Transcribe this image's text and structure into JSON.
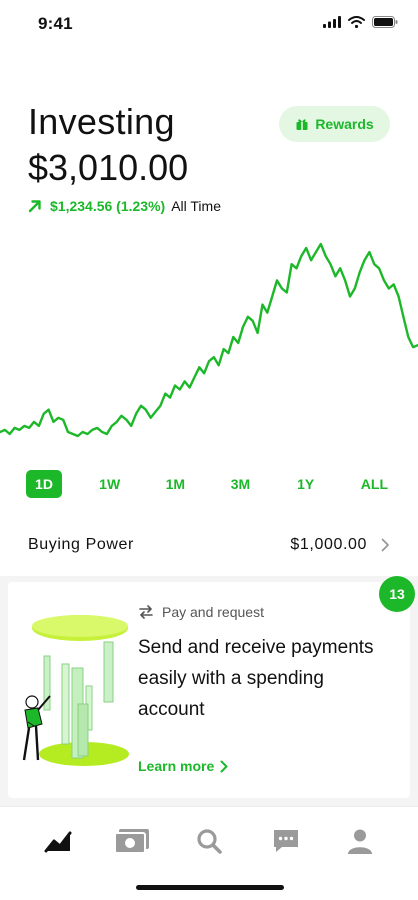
{
  "status_bar": {
    "time": "9:41",
    "icons": [
      "cellular-signal-icon",
      "wifi-icon",
      "battery-icon"
    ]
  },
  "header": {
    "title": "Investing",
    "balance": "$3,010.00",
    "change": {
      "direction_icon": "arrow-up-right-icon",
      "value": "$1,234.56 (1.23%)",
      "period": "All Time"
    }
  },
  "rewards_button": {
    "icon": "gift-icon",
    "label": "Rewards"
  },
  "chart": {
    "type": "line",
    "line_color": "#1cb82a",
    "values": [
      3,
      4,
      2,
      5,
      4,
      6,
      5,
      8,
      6,
      12,
      14,
      8,
      10,
      9,
      3,
      2,
      1,
      3,
      2,
      4,
      5,
      3,
      2,
      6,
      8,
      11,
      9,
      6,
      12,
      16,
      14,
      10,
      13,
      16,
      22,
      20,
      26,
      24,
      28,
      25,
      30,
      35,
      32,
      38,
      40,
      36,
      44,
      42,
      50,
      47,
      55,
      60,
      58,
      52,
      66,
      62,
      70,
      78,
      74,
      72,
      86,
      84,
      90,
      94,
      88,
      92,
      96,
      90,
      86,
      80,
      84,
      78,
      70,
      74,
      82,
      88,
      92,
      86,
      84,
      78,
      74,
      76,
      70,
      60,
      50,
      45,
      46
    ]
  },
  "range_selector": {
    "options": [
      "1D",
      "1W",
      "1M",
      "3M",
      "1Y",
      "ALL"
    ],
    "selected": "1D"
  },
  "buying_power": {
    "label": "Buying Power",
    "value": "$1,000.00"
  },
  "promo_card": {
    "badge_count": "13",
    "kicker_icon": "transfer-arrows-icon",
    "kicker": "Pay and request",
    "text": "Send and receive payments easily with a spending account",
    "link_label": "Learn more"
  },
  "tab_bar": {
    "tabs": [
      {
        "icon": "chart-tab-icon",
        "active": true
      },
      {
        "icon": "cash-tab-icon",
        "active": false
      },
      {
        "icon": "search-tab-icon",
        "active": false
      },
      {
        "icon": "messages-tab-icon",
        "active": false
      },
      {
        "icon": "account-tab-icon",
        "active": false
      }
    ]
  },
  "colors": {
    "accent": "#1cb82a",
    "accent_light": "#e4f7e3",
    "text": "#111111",
    "muted": "#555555"
  }
}
